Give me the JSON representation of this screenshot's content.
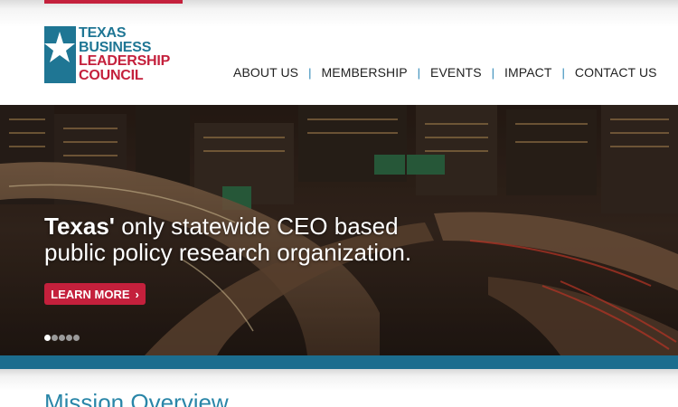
{
  "header": {
    "logo": {
      "lines": [
        "TEXAS",
        "BUSINESS",
        "LEADERSHIP",
        "COUNCIL"
      ],
      "colors": {
        "blue": "#1f7694",
        "red": "#c4203c"
      }
    },
    "nav": [
      {
        "label": "ABOUT US"
      },
      {
        "label": "MEMBERSHIP"
      },
      {
        "label": "EVENTS"
      },
      {
        "label": "IMPACT"
      },
      {
        "label": "CONTACT US"
      }
    ]
  },
  "hero": {
    "headline_bold": "Texas'",
    "headline_rest_line1": " only statewide CEO based",
    "headline_line2": "public policy research organization.",
    "cta_label": "LEARN MORE",
    "slides": 5,
    "active_slide": 1
  },
  "mission": {
    "title": "Mission Overview"
  },
  "colors": {
    "accent_red": "#c4203c",
    "accent_teal": "#1c6d8e",
    "nav_separator": "#2b86b6"
  }
}
